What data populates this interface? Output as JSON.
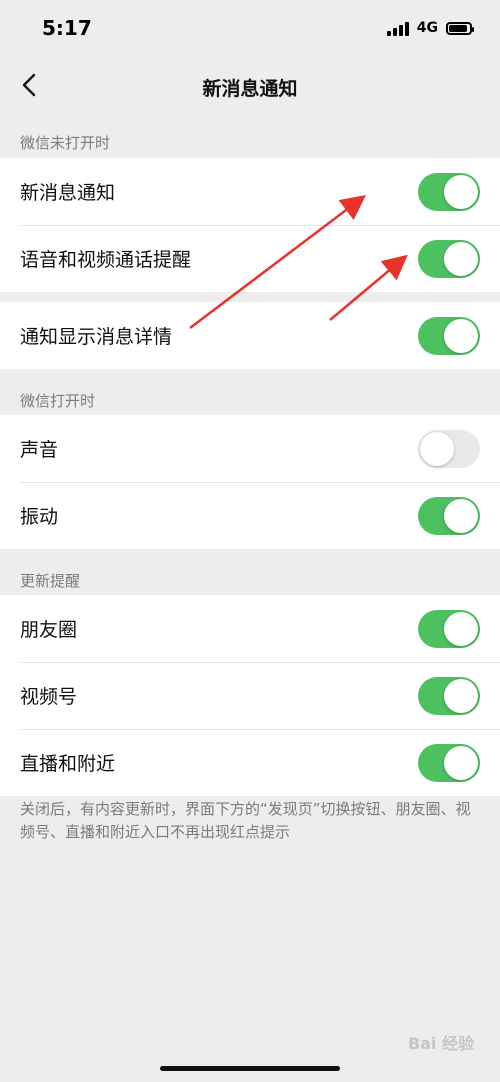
{
  "status_bar": {
    "time": "5:17",
    "network": "4G"
  },
  "nav": {
    "title": "新消息通知"
  },
  "sections": [
    {
      "header": "微信未打开时",
      "rows": [
        {
          "label": "新消息通知",
          "on": true
        },
        {
          "label": "语音和视频通话提醒",
          "on": true
        }
      ]
    },
    {
      "header": "",
      "rows": [
        {
          "label": "通知显示消息详情",
          "on": true
        }
      ]
    },
    {
      "header": "微信打开时",
      "rows": [
        {
          "label": "声音",
          "on": false
        },
        {
          "label": "振动",
          "on": true
        }
      ]
    },
    {
      "header": "更新提醒",
      "rows": [
        {
          "label": "朋友圈",
          "on": true
        },
        {
          "label": "视频号",
          "on": true
        },
        {
          "label": "直播和附近",
          "on": true
        }
      ]
    }
  ],
  "footnote": "关闭后，有内容更新时，界面下方的“发现页”切换按钮、朋友圈、视频号、直播和附近入口不再出现红点提示",
  "watermark": "Bai 经验",
  "colors": {
    "toggle_on": "#4dc05f",
    "toggle_off": "#e9e9ea",
    "annotation_arrow": "#e8332b",
    "background": "#ededed"
  }
}
